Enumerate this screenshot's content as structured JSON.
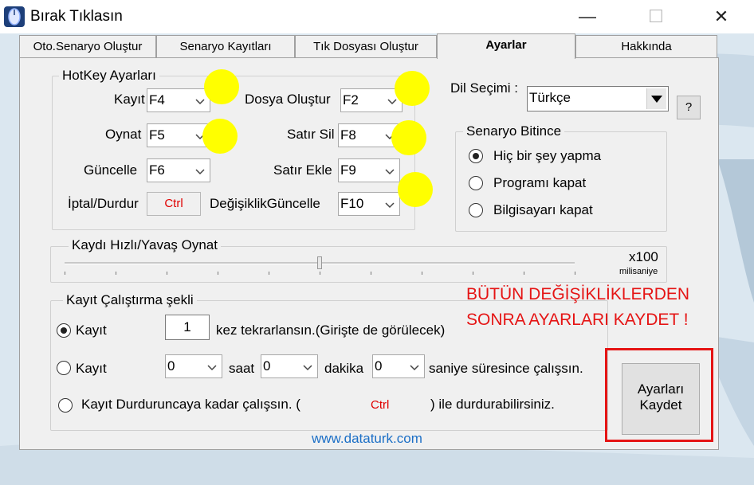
{
  "window": {
    "title": "Bırak Tıklasın",
    "minimize": "—",
    "maximize": "☐",
    "close": "✕"
  },
  "tabs": [
    {
      "label": "Oto.Senaryo Oluştur"
    },
    {
      "label": "Senaryo Kayıtları"
    },
    {
      "label": "Tık Dosyası Oluştur"
    },
    {
      "label": "Ayarlar"
    },
    {
      "label": "Hakkında"
    }
  ],
  "active_tab": "Ayarlar",
  "hotkeys": {
    "title": "HotKey Ayarları",
    "kayit": {
      "label": "Kayıt",
      "value": "F4"
    },
    "oynat": {
      "label": "Oynat",
      "value": "F5"
    },
    "guncelle": {
      "label": "Güncelle",
      "value": "F6"
    },
    "iptal": {
      "label": "İptal/Durdur",
      "value": "Ctrl"
    },
    "dosya": {
      "label": "Dosya Oluştur",
      "value": "F2"
    },
    "satir_sil": {
      "label": "Satır Sil",
      "value": "F8"
    },
    "satir_ekle": {
      "label": "Satır Ekle",
      "value": "F9"
    },
    "degisiklik": {
      "label": "DeğişiklikGüncelle",
      "value": "F10"
    }
  },
  "language": {
    "label": "Dil Seçimi :",
    "value": "Türkçe",
    "help": "?"
  },
  "scenario_end": {
    "title": "Senaryo Bitince",
    "options": [
      {
        "label": "Hiç bir şey yapma",
        "selected": true
      },
      {
        "label": "Programı kapat",
        "selected": false
      },
      {
        "label": "Bilgisayarı kapat",
        "selected": false
      }
    ]
  },
  "speed": {
    "title": "Kaydı Hızlı/Yavaş Oynat",
    "multiplier": "x100",
    "unit": "milisaniye",
    "slider_fraction": 0.5
  },
  "run_mode": {
    "title": "Kayıt Çalıştırma şekli",
    "option1": {
      "label": "Kayıt",
      "selected": true,
      "count": "1",
      "suffix": "kez tekrarlansın.(Girişte de görülecek)"
    },
    "option2": {
      "label": "Kayıt",
      "selected": false,
      "hours": "0",
      "hours_label": "saat",
      "minutes": "0",
      "minutes_label": "dakika",
      "seconds": "0",
      "seconds_label": "saniye süresince çalışsın."
    },
    "option3": {
      "label": "Kayıt Durduruncaya kadar çalışsın.  (",
      "selected": false,
      "key": "Ctrl",
      "suffix": ") ile durdurabilirsiniz."
    }
  },
  "notice": {
    "line1": "BÜTÜN DEĞİŞİKLİKLERDEN",
    "line2": "SONRA AYARLARI KAYDET !"
  },
  "save_button": {
    "line1": "Ayarları",
    "line2": "Kaydet"
  },
  "website": "www.dataturk.com",
  "colors": {
    "accent_red": "#e51414",
    "highlight_yellow": "#ffff00",
    "link_blue": "#1c6fc6",
    "panel_bg": "#f0f0f0"
  }
}
